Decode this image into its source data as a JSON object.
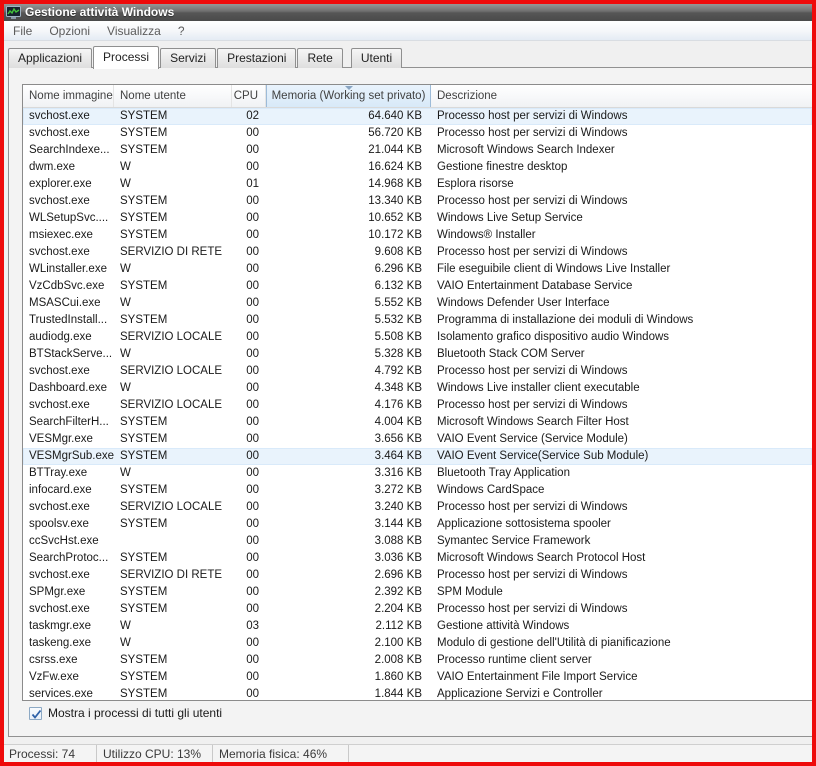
{
  "window": {
    "title": "Gestione attività Windows"
  },
  "menu": {
    "items": [
      "File",
      "Opzioni",
      "Visualizza",
      "?"
    ]
  },
  "tabs": [
    {
      "label": "Applicazioni",
      "active": false
    },
    {
      "label": "Processi",
      "active": true
    },
    {
      "label": "Servizi",
      "active": false
    },
    {
      "label": "Prestazioni",
      "active": false
    },
    {
      "label": "Rete",
      "active": false
    },
    {
      "label": "Utenti",
      "active": false
    }
  ],
  "table": {
    "columns": {
      "name": "Nome immagine",
      "user": "Nome utente",
      "cpu": "CPU",
      "memory": "Memoria (Working set privato)",
      "description": "Descrizione"
    },
    "sorted_column": "Memoria (Working set privato)",
    "sort_direction": "descending",
    "selected_rows": [
      0,
      20
    ],
    "rows": [
      [
        "svchost.exe",
        "SYSTEM",
        "02",
        "64.640 KB",
        "Processo host per servizi di Windows"
      ],
      [
        "svchost.exe",
        "SYSTEM",
        "00",
        "56.720 KB",
        "Processo host per servizi di Windows"
      ],
      [
        "SearchIndexe...",
        "SYSTEM",
        "00",
        "21.044 KB",
        "Microsoft Windows Search Indexer"
      ],
      [
        "dwm.exe",
        "W",
        "00",
        "16.624 KB",
        "Gestione finestre desktop"
      ],
      [
        "explorer.exe",
        "W",
        "01",
        "14.968 KB",
        "Esplora risorse"
      ],
      [
        "svchost.exe",
        "SYSTEM",
        "00",
        "13.340 KB",
        "Processo host per servizi di Windows"
      ],
      [
        "WLSetupSvc....",
        "SYSTEM",
        "00",
        "10.652 KB",
        "Windows Live Setup Service"
      ],
      [
        "msiexec.exe",
        "SYSTEM",
        "00",
        "10.172 KB",
        "Windows® Installer"
      ],
      [
        "svchost.exe",
        "SERVIZIO DI RETE",
        "00",
        "9.608 KB",
        "Processo host per servizi di Windows"
      ],
      [
        "WLinstaller.exe",
        "W",
        "00",
        "6.296 KB",
        "File eseguibile client di Windows Live Installer"
      ],
      [
        "VzCdbSvc.exe",
        "SYSTEM",
        "00",
        "6.132 KB",
        "VAIO Entertainment Database Service"
      ],
      [
        "MSASCui.exe",
        "W",
        "00",
        "5.552 KB",
        "Windows Defender User Interface"
      ],
      [
        "TrustedInstall...",
        "SYSTEM",
        "00",
        "5.532 KB",
        "Programma di installazione dei moduli di Windows"
      ],
      [
        "audiodg.exe",
        "SERVIZIO LOCALE",
        "00",
        "5.508 KB",
        "Isolamento grafico dispositivo audio Windows"
      ],
      [
        "BTStackServe...",
        "W",
        "00",
        "5.328 KB",
        "Bluetooth Stack COM Server"
      ],
      [
        "svchost.exe",
        "SERVIZIO LOCALE",
        "00",
        "4.792 KB",
        "Processo host per servizi di Windows"
      ],
      [
        "Dashboard.exe",
        "W",
        "00",
        "4.348 KB",
        "Windows Live installer client executable"
      ],
      [
        "svchost.exe",
        "SERVIZIO LOCALE",
        "00",
        "4.176 KB",
        "Processo host per servizi di Windows"
      ],
      [
        "SearchFilterH...",
        "SYSTEM",
        "00",
        "4.004 KB",
        "Microsoft Windows Search Filter Host"
      ],
      [
        "VESMgr.exe",
        "SYSTEM",
        "00",
        "3.656 KB",
        "VAIO Event Service (Service Module)"
      ],
      [
        "VESMgrSub.exe",
        "SYSTEM",
        "00",
        "3.464 KB",
        "VAIO Event Service(Service Sub Module)"
      ],
      [
        "BTTray.exe",
        "W",
        "00",
        "3.316 KB",
        "Bluetooth Tray Application"
      ],
      [
        "infocard.exe",
        "SYSTEM",
        "00",
        "3.272 KB",
        "Windows CardSpace"
      ],
      [
        "svchost.exe",
        "SERVIZIO LOCALE",
        "00",
        "3.240 KB",
        "Processo host per servizi di Windows"
      ],
      [
        "spoolsv.exe",
        "SYSTEM",
        "00",
        "3.144 KB",
        "Applicazione sottosistema spooler"
      ],
      [
        "ccSvcHst.exe",
        "",
        "00",
        "3.088 KB",
        "Symantec Service Framework"
      ],
      [
        "SearchProtoc...",
        "SYSTEM",
        "00",
        "3.036 KB",
        "Microsoft Windows Search Protocol Host"
      ],
      [
        "svchost.exe",
        "SERVIZIO DI RETE",
        "00",
        "2.696 KB",
        "Processo host per servizi di Windows"
      ],
      [
        "SPMgr.exe",
        "SYSTEM",
        "00",
        "2.392 KB",
        "SPM Module"
      ],
      [
        "svchost.exe",
        "SYSTEM",
        "00",
        "2.204 KB",
        "Processo host per servizi di Windows"
      ],
      [
        "taskmgr.exe",
        "W",
        "03",
        "2.112 KB",
        "Gestione attività Windows"
      ],
      [
        "taskeng.exe",
        "W",
        "00",
        "2.100 KB",
        "Modulo di gestione dell'Utilità di pianificazione"
      ],
      [
        "csrss.exe",
        "SYSTEM",
        "00",
        "2.008 KB",
        "Processo runtime client server"
      ],
      [
        "VzFw.exe",
        "SYSTEM",
        "00",
        "1.860 KB",
        "VAIO Entertainment File Import Service"
      ],
      [
        "services.exe",
        "SYSTEM",
        "00",
        "1.844 KB",
        "Applicazione Servizi e Controller"
      ]
    ]
  },
  "footer": {
    "checkbox_label": "Mostra i processi di tutti gli utenti",
    "checkbox_checked": true
  },
  "status_bar": {
    "processes": "Processi: 74",
    "cpu": "Utilizzo CPU: 13%",
    "memory": "Memoria fisica: 46%"
  },
  "colors": {
    "frame_red": "#ee0a0a",
    "titlebar_gray": "#6e6e6e",
    "sorted_header_blue": "#d8e9f8",
    "selection_blue": "#e9f3fc"
  }
}
